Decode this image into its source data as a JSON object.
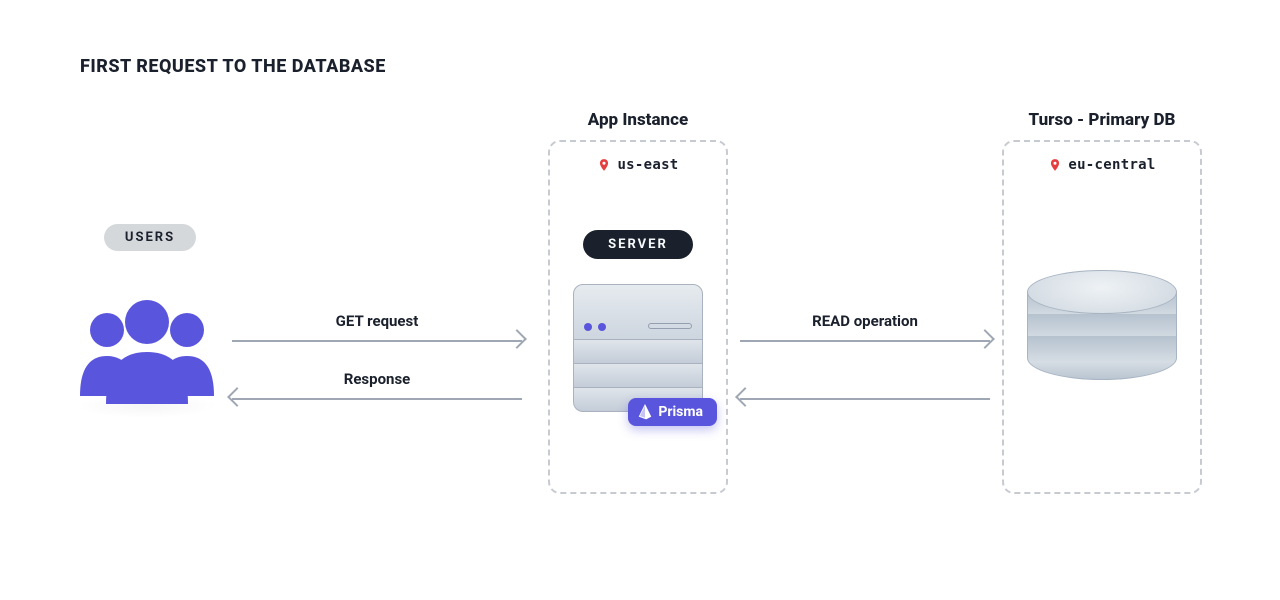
{
  "title": "FIRST REQUEST TO THE DATABASE",
  "users": {
    "label": "USERS"
  },
  "arrows": {
    "get_request": "GET request",
    "response": "Response",
    "read_operation": "READ operation"
  },
  "app_instance": {
    "heading": "App Instance",
    "region": "us-east",
    "server_label": "SERVER",
    "prisma_label": "Prisma"
  },
  "turso": {
    "heading": "Turso - Primary DB",
    "region": "eu-central"
  },
  "colors": {
    "accent_purple": "#5a55dd",
    "pin_red": "#e53e3e",
    "text": "#1a202c"
  }
}
